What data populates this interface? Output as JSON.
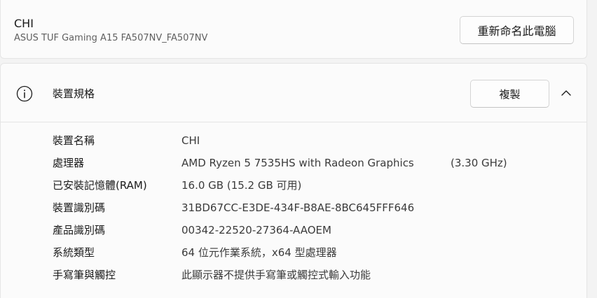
{
  "device": {
    "name": "CHI",
    "model": "ASUS TUF Gaming A15 FA507NV_FA507NV",
    "rename_button": "重新命名此電腦"
  },
  "specs": {
    "title": "裝置規格",
    "copy_button": "複製",
    "rows": [
      {
        "label": "裝置名稱",
        "value": "CHI"
      },
      {
        "label": "處理器",
        "value": "AMD Ryzen 5 7535HS with Radeon Graphics",
        "extra": "(3.30 GHz)"
      },
      {
        "label": "已安裝記憶體(RAM)",
        "value": "16.0 GB (15.2 GB 可用)"
      },
      {
        "label": "裝置識別碼",
        "value": "31BD67CC-E3DE-434F-B8AE-8BC645FFF646"
      },
      {
        "label": "產品識別碼",
        "value": "00342-22520-27364-AAOEM"
      },
      {
        "label": "系統類型",
        "value": "64 位元作業系統，x64 型處理器"
      },
      {
        "label": "手寫筆與觸控",
        "value": "此顯示器不提供手寫筆或觸控式輸入功能"
      }
    ]
  },
  "icons": {
    "info": "info-icon",
    "collapse": "chevron-up-icon"
  }
}
